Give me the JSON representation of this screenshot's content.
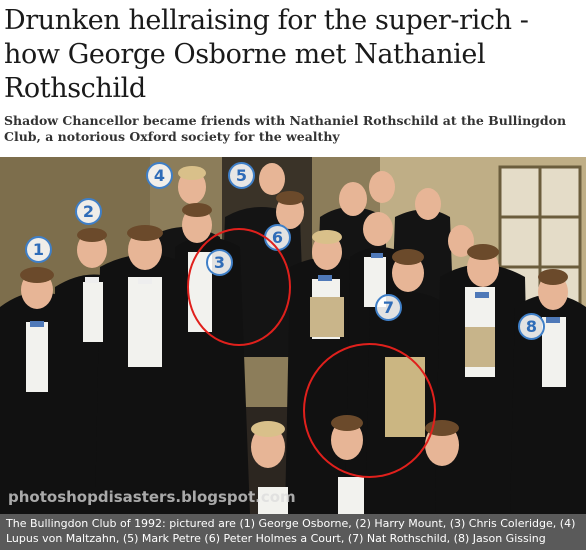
{
  "article": {
    "headline": "Drunken hellraising for the super-rich - how George Osborne met Nathaniel Rothschild",
    "standfirst": "Shadow Chancellor became friends with Nathaniel Rothschild at the Bullingdon Club, a notorious Oxford society for the wealthy"
  },
  "photo": {
    "watermark": "photoshopdisasters.blogspot.com",
    "markers": [
      "1",
      "2",
      "3",
      "4",
      "5",
      "6",
      "7",
      "8"
    ],
    "caption": "The Bullingdon Club of 1992: pictured are (1) George Osborne, (2) Harry Mount, (3) Chris Coleridge, (4) Lupus von Maltzahn, (5) Mark Petre (6) Peter Holmes a Court, (7) Nat Rothschild, (8) Jason Gissing"
  },
  "colors": {
    "marker_ring": "#3f7fc7",
    "highlight_circle": "#e0201c",
    "caption_bg": "#5a5a5a"
  }
}
